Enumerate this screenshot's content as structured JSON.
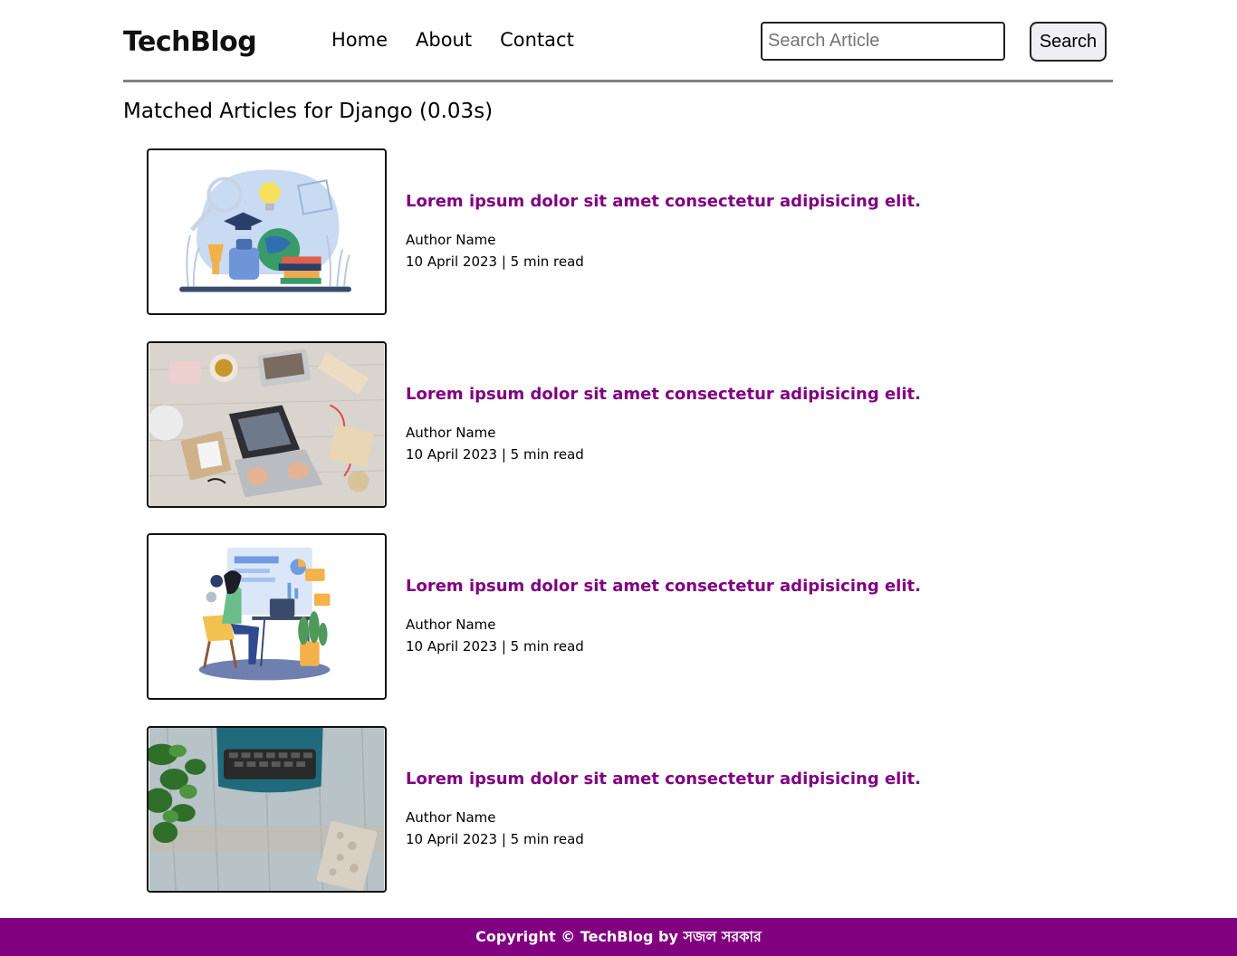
{
  "header": {
    "logo": "TechBlog",
    "nav": [
      "Home",
      "About",
      "Contact"
    ],
    "search_placeholder": "Search Article",
    "search_value": "",
    "search_button": "Search"
  },
  "results": {
    "title": "Matched Articles for Django (0.03s)"
  },
  "articles": [
    {
      "image": "education-illustration",
      "title": "Lorem ipsum dolor sit amet consectetur adipisicing elit.",
      "author": "Author Name",
      "meta": "10 April 2023 | 5 min read"
    },
    {
      "image": "laptop-desk-photo",
      "title": "Lorem ipsum dolor sit amet consectetur adipisicing elit.",
      "author": "Author Name",
      "meta": "10 April 2023 | 5 min read"
    },
    {
      "image": "developer-workspace-illustration",
      "title": "Lorem ipsum dolor sit amet consectetur adipisicing elit.",
      "author": "Author Name",
      "meta": "10 April 2023 | 5 min read"
    },
    {
      "image": "typewriter-photo",
      "title": "Lorem ipsum dolor sit amet consectetur adipisicing elit.",
      "author": "Author Name",
      "meta": "10 April 2023 | 5 min read"
    }
  ],
  "footer": {
    "text": "Copyright © TechBlog by সজল সরকার"
  },
  "colors": {
    "accent": "#800080",
    "divider": "#808080"
  }
}
